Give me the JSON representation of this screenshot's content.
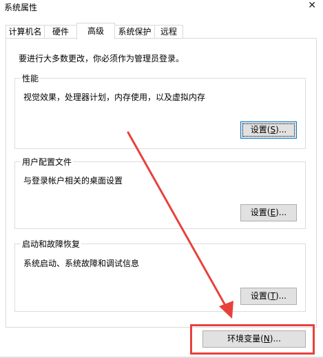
{
  "window": {
    "title": "系统属性",
    "close_symbol": "✕"
  },
  "tabs": [
    {
      "label": "计算机名",
      "active": false
    },
    {
      "label": "硬件",
      "active": false
    },
    {
      "label": "高级",
      "active": true
    },
    {
      "label": "系统保护",
      "active": false
    },
    {
      "label": "远程",
      "active": false
    }
  ],
  "advanced": {
    "notice": "要进行大多数更改，你必须作为管理员登录。",
    "performance": {
      "title": "性能",
      "desc": "视觉效果，处理器计划，内存使用，以及虚拟内存",
      "button_pre": "设置(",
      "button_key": "S",
      "button_post": ")..."
    },
    "user_profiles": {
      "title": "用户配置文件",
      "desc": "与登录帐户相关的桌面设置",
      "button_pre": "设置(",
      "button_key": "E",
      "button_post": ")..."
    },
    "startup_recovery": {
      "title": "启动和故障恢复",
      "desc": "系统启动、系统故障和调试信息",
      "button_pre": "设置(",
      "button_key": "T",
      "button_post": ")..."
    },
    "env_button": {
      "pre": "环境变量(",
      "key": "N",
      "post": ")..."
    }
  },
  "annotation": {
    "color": "#e8413b"
  }
}
